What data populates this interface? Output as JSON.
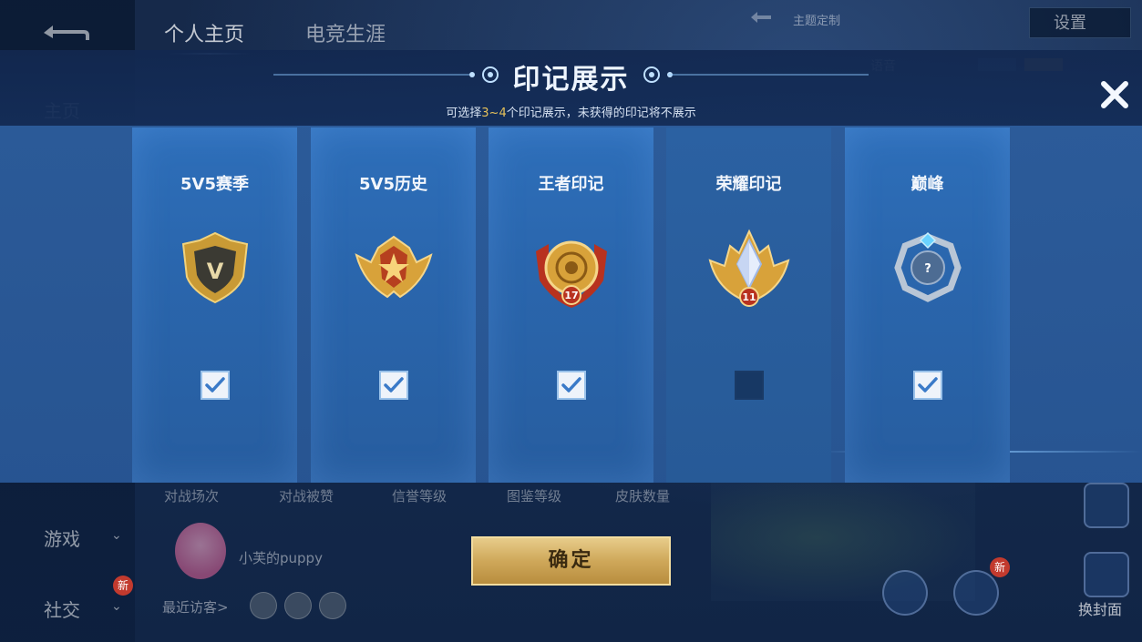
{
  "background": {
    "tabs": [
      "个人主页",
      "电竞生涯"
    ],
    "sidebar": {
      "home": "主页",
      "games": "游戏",
      "social": "社交",
      "new_badge": "新"
    },
    "settings_label": "设置",
    "theme_label": "主题定制",
    "voice_label": "语音",
    "stats": [
      "对战场次",
      "对战被赞",
      "信誉等级",
      "图鉴等级",
      "皮肤数量"
    ],
    "player_name": "小芙的puppy",
    "recent_visitors": "最近访客>",
    "change_cover": "换封面"
  },
  "modal": {
    "title": "印记展示",
    "subtitle_prefix": "可选择",
    "subtitle_highlight": "3~4",
    "subtitle_suffix": "个印记展示，未获得的印记将不展示",
    "confirm_label": "确定",
    "cards": [
      {
        "label": "5V5赛季",
        "badge": "season-v-shield-icon",
        "checked": true,
        "number": ""
      },
      {
        "label": "5V5历史",
        "badge": "history-star-wings-icon",
        "checked": true,
        "number": ""
      },
      {
        "label": "王者印记",
        "badge": "king-emblem-icon",
        "checked": true,
        "number": "17"
      },
      {
        "label": "荣耀印记",
        "badge": "glory-crystal-emblem-icon",
        "checked": false,
        "number": "11"
      },
      {
        "label": "巅峰",
        "badge": "peak-locked-emblem-icon",
        "checked": true,
        "number": "?"
      }
    ]
  },
  "colors": {
    "highlight": "#e7c25a",
    "panel": "#2a66ad",
    "confirm_gold": "#cfa85a"
  }
}
